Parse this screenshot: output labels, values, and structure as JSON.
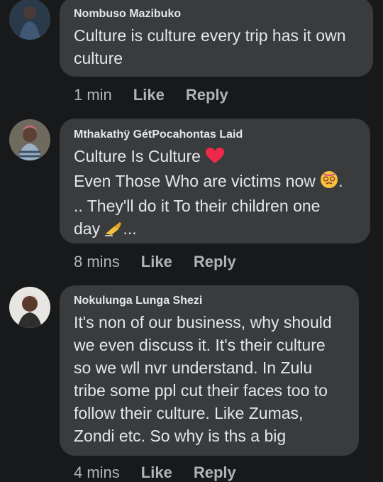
{
  "comments": [
    {
      "author": "Nombuso Mazibuko",
      "lines": [
        "Culture is culture every trip has it own",
        "culture"
      ],
      "time": "1 min",
      "like": "Like",
      "reply": "Reply"
    },
    {
      "author": "Mthakathÿ GétPocahontas Laid",
      "lines": [
        "Culture Is Culture",
        "Even Those Who are victims now",
        ".. They'll do it To their children one",
        "day"
      ],
      "line4_suffix": "...",
      "line2_suffix": ".",
      "time": "8 mins",
      "like": "Like",
      "reply": "Reply"
    },
    {
      "author": "Nokulunga Lunga Shezi",
      "lines": [
        "It's non of our business, why should",
        "we even discuss it. It's their culture",
        "so we wll nvr understand. In Zulu",
        "tribe some ppl cut their faces too to",
        "follow their culture. Like Zumas,",
        "Zondi etc. So why is ths a big"
      ],
      "time": "4 mins",
      "like": "Like",
      "reply": "Reply"
    }
  ],
  "icons": {
    "heart": "heart-icon",
    "face": "face-with-spiral-eyes-icon",
    "writing": "writing-hand-icon"
  },
  "colors": {
    "background": "#18191a",
    "bubble": "#3a3b3c",
    "text": "#e4e6eb",
    "secondary": "#b0b3b8",
    "heart": "#f0284a"
  }
}
